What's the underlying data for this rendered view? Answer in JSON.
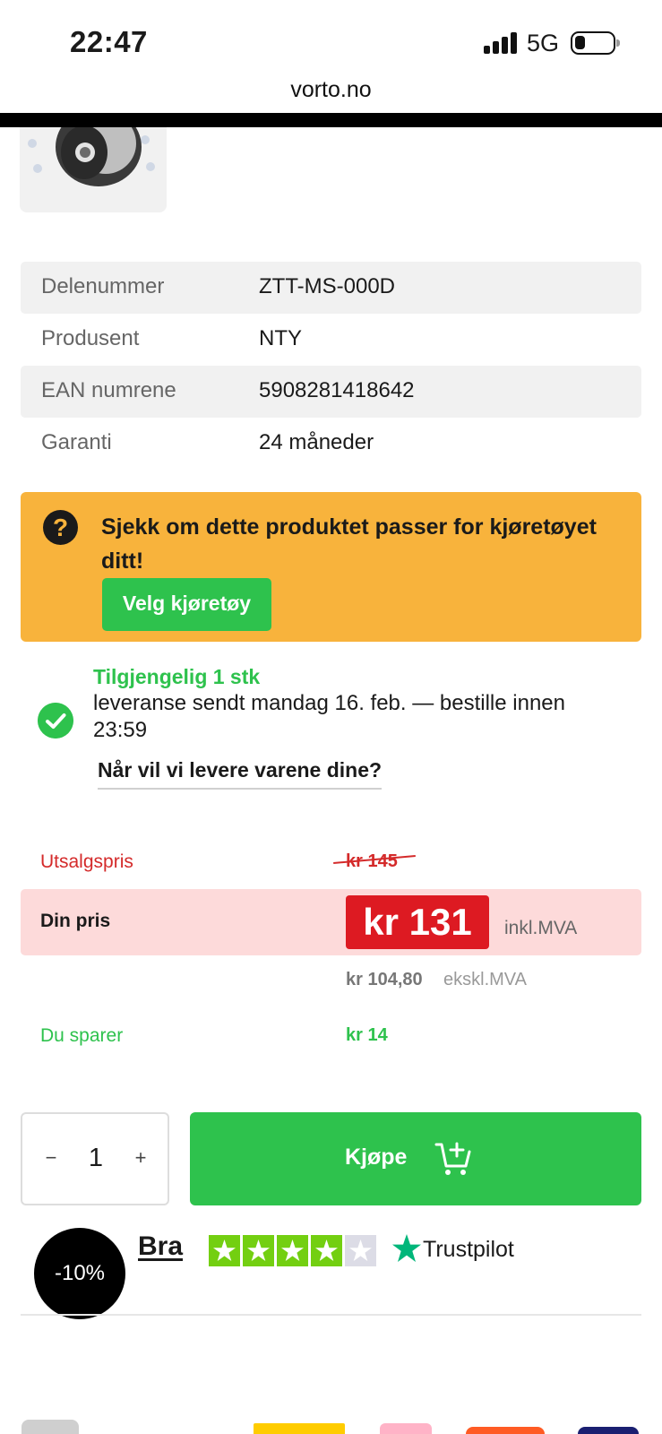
{
  "status_bar": {
    "time": "22:47",
    "network": "5G",
    "icons": [
      "signal-icon",
      "battery-icon"
    ]
  },
  "browser": {
    "url": "vorto.no"
  },
  "specs": [
    {
      "label": "Delenummer",
      "value": "ZTT-MS-000D"
    },
    {
      "label": "Produsent",
      "value": "NTY"
    },
    {
      "label": "EAN numrene",
      "value": "5908281418642"
    },
    {
      "label": "Garanti",
      "value": "24 måneder"
    }
  ],
  "vehicle_check": {
    "text": "Sjekk om dette produktet passer for kjøretøyet ditt!",
    "button": "Velg kjøretøy",
    "icon": "question-icon",
    "color": "#f8b33c"
  },
  "availability": {
    "title": "Tilgjengelig 1 stk",
    "text": "leveranse sendt mandag 16. feb. — bestille innen 23:59",
    "link": "Når vil vi levere varene dine?",
    "icon": "check-circle-icon"
  },
  "pricing": {
    "utsalg_label": "Utsalgspris",
    "utsalg_price": "kr 145",
    "din_label": "Din pris",
    "din_price": "kr 131",
    "inkl_label": "inkl.MVA",
    "ex_price": "kr 104,80",
    "ex_label": "ekskl.MVA",
    "spar_label": "Du sparer",
    "spar_value": "kr 14",
    "colors": {
      "sale": "#d42a2a",
      "price_badge": "#dd1a22",
      "savings": "#2ec24d"
    }
  },
  "purchase": {
    "minus": "−",
    "quantity": "1",
    "plus": "+",
    "buy_label": "Kjøpe",
    "buy_icon": "cart-plus-icon",
    "color": "#2ec24d"
  },
  "trustpilot": {
    "discount": "-10%",
    "rating_word": "Bra",
    "stars_filled": 4,
    "stars_total": 5,
    "brand": "Trustpilot"
  }
}
